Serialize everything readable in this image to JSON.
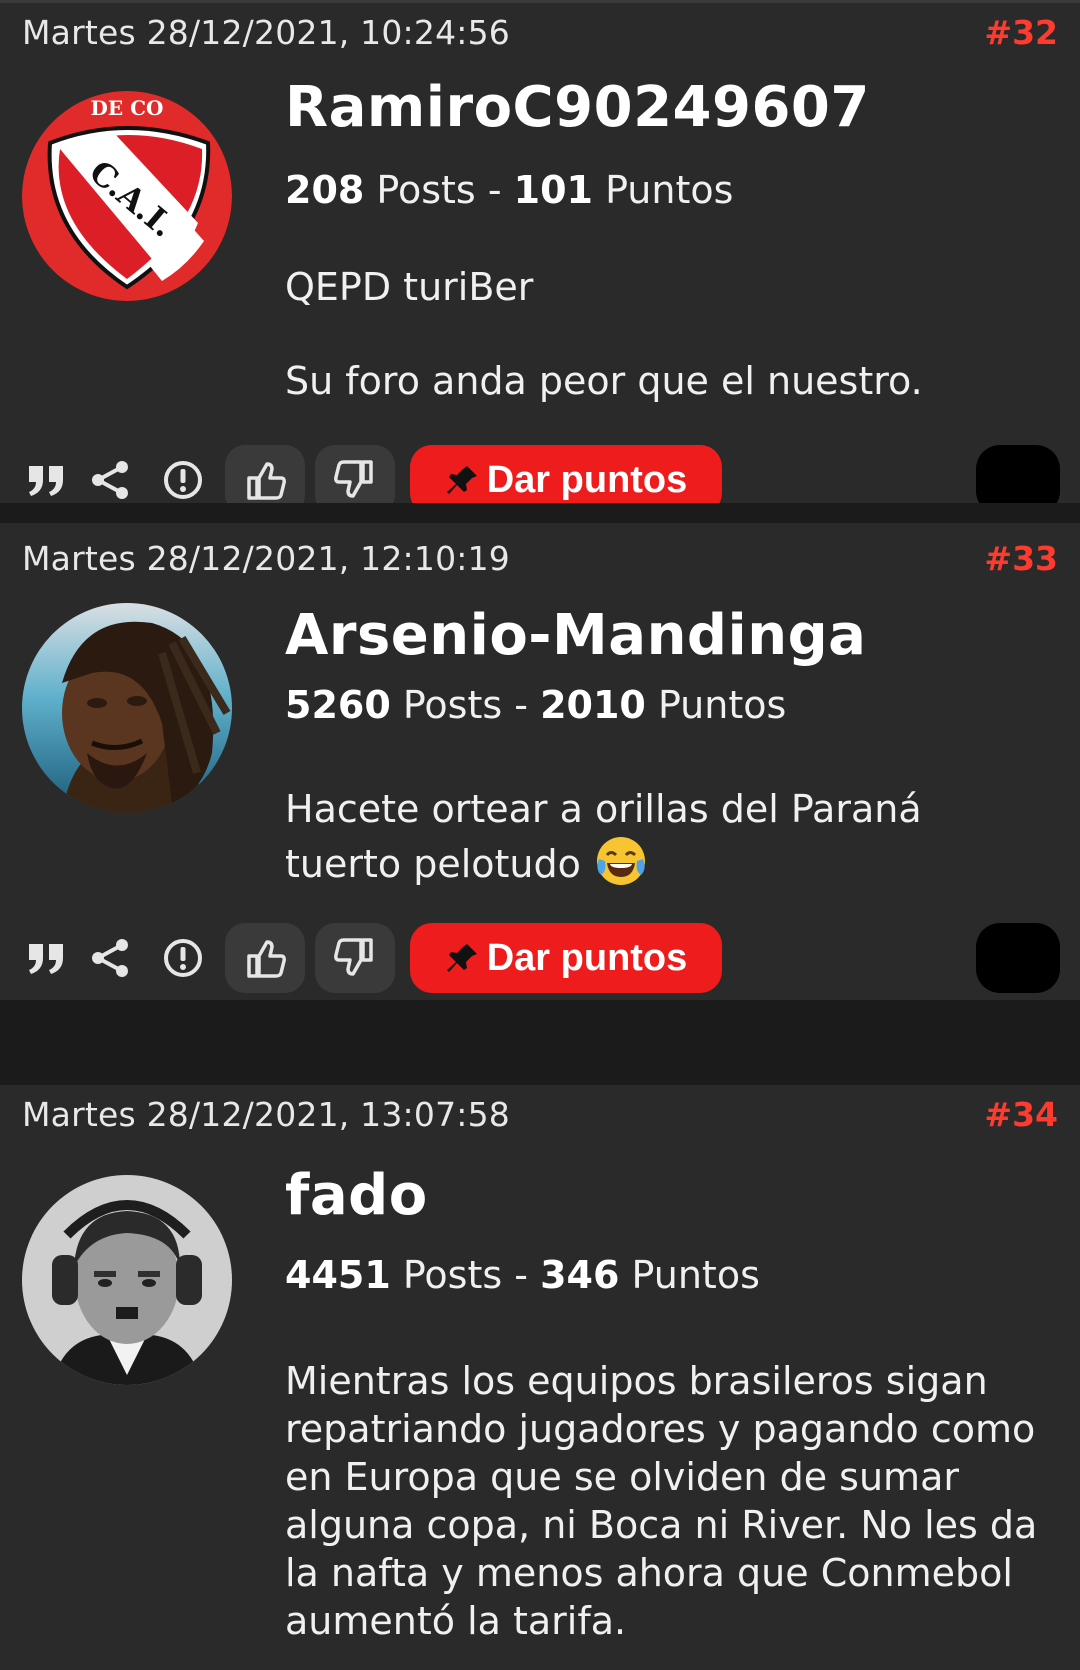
{
  "posts": [
    {
      "date": "Martes 28/12/2021, 10:24:56",
      "number": "#32",
      "username": "RamiroC90249607",
      "posts_count": "208",
      "posts_label": "Posts",
      "separator": "-",
      "points_count": "101",
      "points_label": "Puntos",
      "avatar": "cai-shield-icon",
      "avatar_text": "C.A.I.",
      "avatar_ring_text": "DE CO",
      "body": [
        "QEPD turiBer",
        "Su foro anda peor que el nuestro."
      ],
      "dar_puntos_label": "Dar puntos"
    },
    {
      "date": "Martes 28/12/2021, 12:10:19",
      "number": "#33",
      "username": "Arsenio-Mandinga",
      "posts_count": "5260",
      "posts_label": "Posts",
      "separator": "-",
      "points_count": "2010",
      "points_label": "Puntos",
      "avatar": "man-portrait",
      "body_line1": "Hacete ortear a orillas del Paraná",
      "body_line2": "tuerto pelotudo",
      "body_emoji": "laughing-tears-emoji",
      "dar_puntos_label": "Dar puntos"
    },
    {
      "date": "Martes 28/12/2021, 13:07:58",
      "number": "#34",
      "username": "fado",
      "posts_count": "4451",
      "posts_label": "Posts",
      "separator": "-",
      "points_count": "346",
      "points_label": "Puntos",
      "avatar": "bw-portrait-headphones",
      "body": "Mientras los equipos brasileros sigan repatriando jugadores y pagando como en Europa que se olviden de sumar alguna copa, ni Boca ni River. No les da la nafta y menos ahora que Conmebol aumentó la tarifa."
    }
  ],
  "icons": {
    "quote": "quote-icon",
    "share": "share-icon",
    "report": "report-icon",
    "like": "thumbs-up-icon",
    "dislike": "thumbs-down-icon",
    "pin": "pin-icon"
  },
  "colors": {
    "background": "#1b1b1b",
    "post_background": "#2a2a2a",
    "accent": "#ff3b2f",
    "button_red": "#ee1c1c"
  }
}
